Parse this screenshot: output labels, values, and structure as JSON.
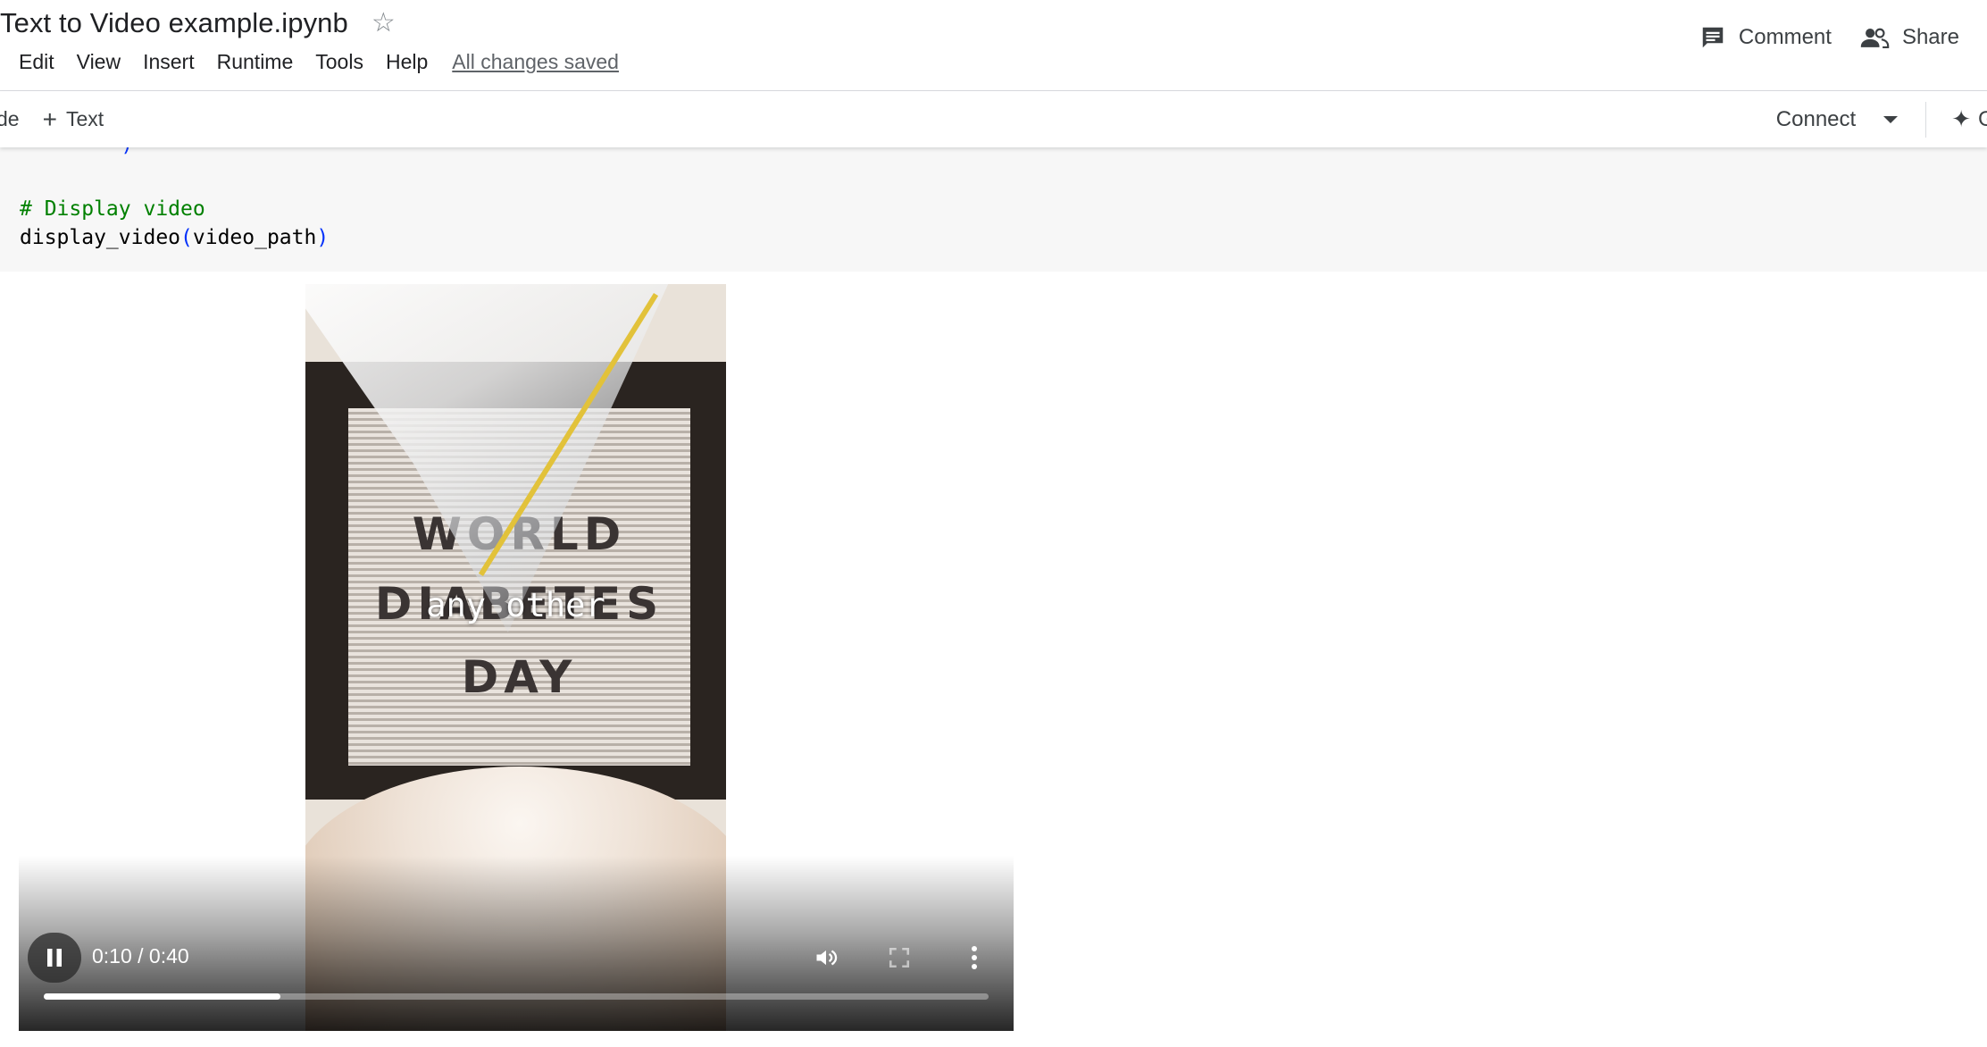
{
  "header": {
    "notebook_title": "Text to Video example.ipynb",
    "menu": [
      "Edit",
      "View",
      "Insert",
      "Runtime",
      "Tools",
      "Help"
    ],
    "save_status": "All changes saved",
    "comment_label": "Comment",
    "share_label": "Share"
  },
  "toolbar": {
    "code_label_partial": "de",
    "text_button_label": "Text",
    "connect_label": "Connect",
    "gemini_label_partial": "Ge"
  },
  "code_cell": {
    "partial_line": "\"\"\"\"",
    "partial_paren": ")",
    "comment_line": "# Display video",
    "call_fn": "display_video",
    "call_open": "(",
    "call_arg": "video_path",
    "call_close": ")"
  },
  "video": {
    "overlay_caption": "any other",
    "board_lines": [
      "WORLD",
      "DIABETES",
      "DAY"
    ],
    "time_display": "0:10 / 0:40",
    "current_seconds": 10,
    "duration_seconds": 40
  },
  "icons": {
    "star": "star-icon",
    "comment": "comment-icon",
    "share": "people-icon",
    "pause": "pause-icon",
    "volume": "volume-icon",
    "fullscreen": "fullscreen-icon",
    "more": "more-vert-icon"
  },
  "colors": {
    "code_comment": "#008000",
    "code_paren": "#0431fa",
    "code_string": "#a31515",
    "cell_background": "#f7f7f7"
  }
}
